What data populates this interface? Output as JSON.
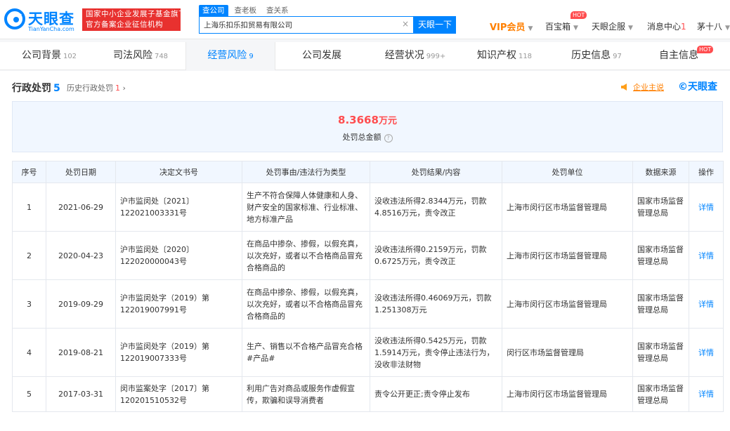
{
  "header": {
    "logo_cn": "天眼查",
    "logo_en": "TianYanCha.com",
    "gov_badge_line1": "国家中小企业发展子基金旗下",
    "gov_badge_line2": "官方备案企业征信机构",
    "search_tabs": [
      "查公司",
      "查老板",
      "查关系"
    ],
    "search_value": "上海乐扣乐扣贸易有限公司",
    "search_button": "天眼一下",
    "vip": "VIP会员",
    "nav": {
      "baibaoxiang": "百宝箱",
      "qifu": "天眼企服",
      "messages": "消息中心",
      "messages_count": "1",
      "user": "茅十八"
    },
    "hot": "HOT"
  },
  "tabs": [
    {
      "label": "公司背景",
      "count": "102"
    },
    {
      "label": "司法风险",
      "count": "748"
    },
    {
      "label": "经营风险",
      "count": "9"
    },
    {
      "label": "公司发展",
      "count": ""
    },
    {
      "label": "经营状况",
      "count": "999+"
    },
    {
      "label": "知识产权",
      "count": "118"
    },
    {
      "label": "历史信息",
      "count": "97"
    },
    {
      "label": "自主信息",
      "count": ""
    }
  ],
  "section": {
    "title": "行政处罚",
    "count": "5",
    "history_label": "历史行政处罚",
    "history_count": "1",
    "owner_link": "企业主说",
    "brand": "天眼查"
  },
  "summary": {
    "amount": "8.3668",
    "unit": "万元",
    "label": "处罚总金额"
  },
  "table": {
    "headers": [
      "序号",
      "处罚日期",
      "决定文书号",
      "处罚事由/违法行为类型",
      "处罚结果/内容",
      "处罚单位",
      "数据来源",
      "操作"
    ],
    "rows": [
      {
        "no": "1",
        "date": "2021-06-29",
        "doc": "沪市监闵处〔2021〕122021003331号",
        "reason": "生产不符合保障人体健康和人身、财产安全的国家标准、行业标准、地方标准产品",
        "result": "没收违法所得2.8344万元，罚款4.8516万元，责令改正",
        "unit": "上海市闵行区市场监督管理局",
        "source": "国家市场监督管理总局",
        "action": "详情"
      },
      {
        "no": "2",
        "date": "2020-04-23",
        "doc": "沪市监闵处〔2020〕122020000043号",
        "reason": "在商品中掺杂、掺假，以假充真，以次充好，或者以不合格商品冒充合格商品的",
        "result": "没收违法所得0.2159万元，罚款0.6725万元，责令改正",
        "unit": "上海市闵行区市场监督管理局",
        "source": "国家市场监督管理总局",
        "action": "详情"
      },
      {
        "no": "3",
        "date": "2019-09-29",
        "doc": "沪市监闵处字（2019）第122019007991号",
        "reason": "在商品中掺杂、掺假，以假充真，以次充好，或者以不合格商品冒充合格商品的",
        "result": "没收违法所得0.46069万元，罚款1.251308万元",
        "unit": "上海市闵行区市场监督管理局",
        "source": "国家市场监督管理总局",
        "action": "详情"
      },
      {
        "no": "4",
        "date": "2019-08-21",
        "doc": "沪市监闵处字（2019）第122019007333号",
        "reason": "生产、销售以不合格产品冒充合格#产品#",
        "result": "没收违法所得0.5425万元，罚款1.5914万元，责令停止违法行为，没收非法财物",
        "unit": "闵行区市场监督管理局",
        "source": "国家市场监督管理总局",
        "action": "详情"
      },
      {
        "no": "5",
        "date": "2017-03-31",
        "doc": "闵市监案处字〔2017〕第120201510532号",
        "reason": "利用广告对商品或服务作虚假宣传，欺骗和误导消费者",
        "result": "责令公开更正;责令停止发布",
        "unit": "上海市闵行区市场监督管理局",
        "source": "国家市场监督管理总局",
        "action": "详情"
      }
    ]
  },
  "colors": {
    "brand_blue": "#0084ff",
    "danger_red": "#ff4d4f",
    "vip_orange": "#ff7f00"
  }
}
